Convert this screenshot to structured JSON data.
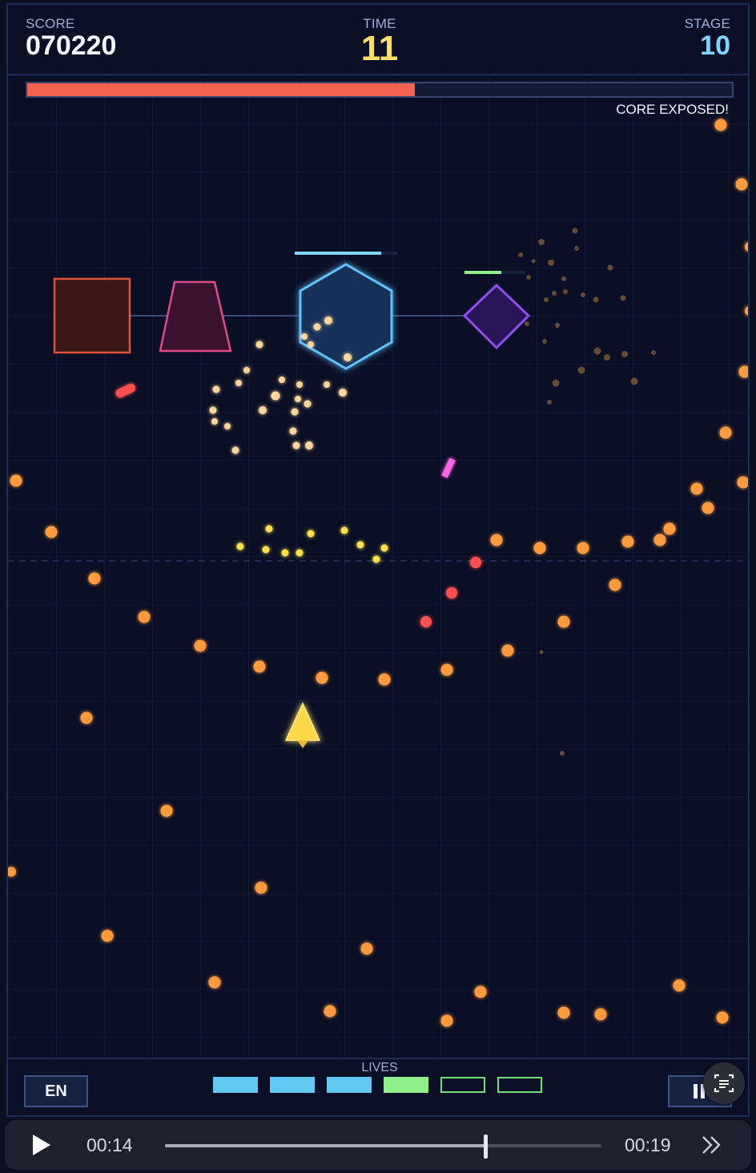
{
  "hud": {
    "score_label": "SCORE",
    "score": "070220",
    "time_label": "TIME",
    "time": "11",
    "stage_label": "STAGE",
    "stage": "10"
  },
  "boss": {
    "health_fraction": 0.55,
    "status_text": "CORE EXPOSED!",
    "bar_color": "#f0614f"
  },
  "footer": {
    "language_label": "EN",
    "lives_label": "LIVES",
    "lives": [
      {
        "state": "filled",
        "color": "#62c9f5"
      },
      {
        "state": "filled",
        "color": "#62c9f5"
      },
      {
        "state": "filled",
        "color": "#62c9f5"
      },
      {
        "state": "filled",
        "color": "#8ff08a"
      },
      {
        "state": "empty",
        "color": "#6ee07a"
      },
      {
        "state": "empty",
        "color": "#6ee07a"
      }
    ],
    "pause_icon": "pause-icon"
  },
  "colors": {
    "enemy_bullet": "#ff9a3c",
    "red_bullet": "#ff5050",
    "player_ship": "#ffd84a",
    "shield_hex": "#4fb6ff",
    "diamond": "#8f4cf0",
    "square": "#e0533f",
    "trapezoid": "#e04a8a"
  },
  "media_player": {
    "current_time": "00:14",
    "duration": "00:19",
    "progress": 0.737,
    "play_icon": "play-icon",
    "forward_icon": "fast-forward-icon",
    "scan_icon": "scan-text-icon"
  }
}
